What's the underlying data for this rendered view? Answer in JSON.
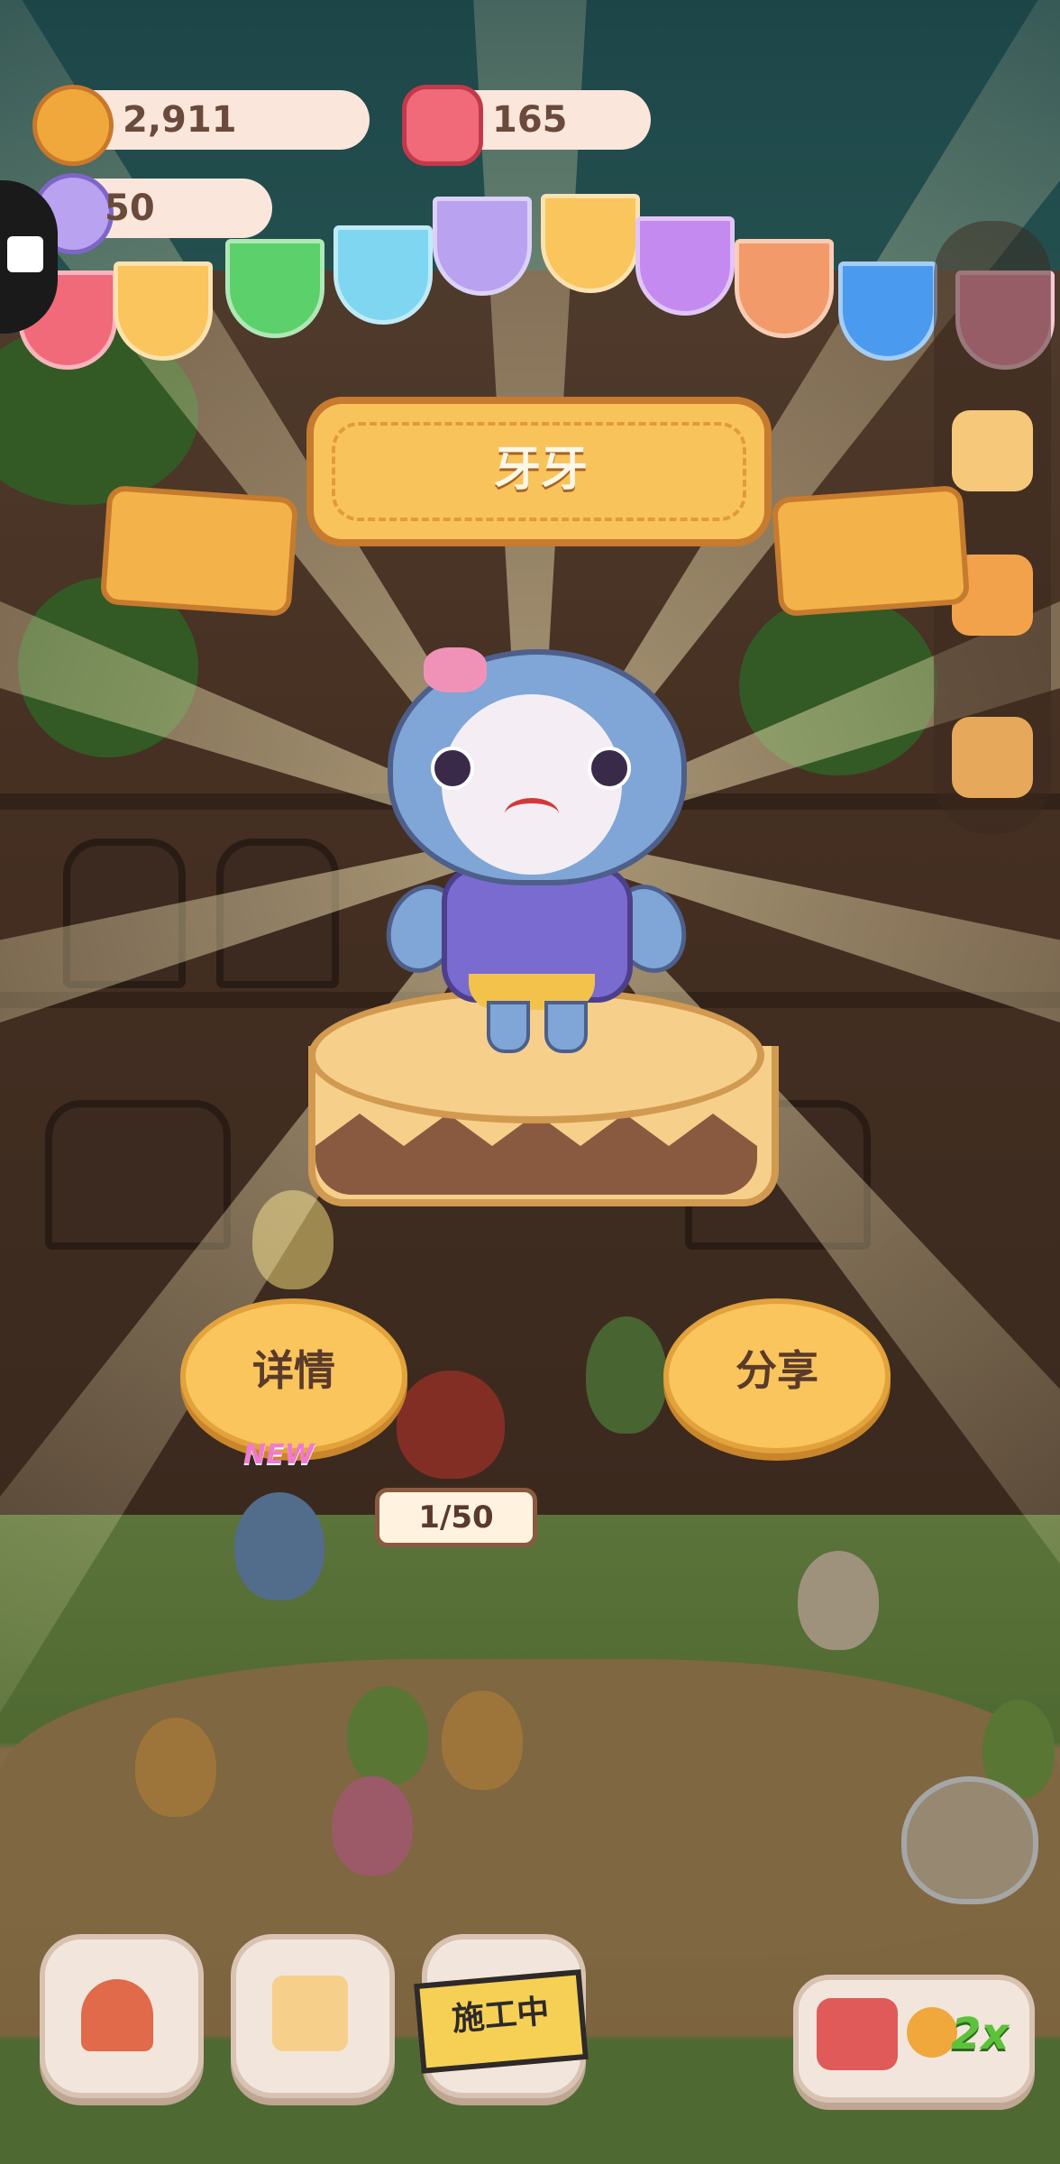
{
  "currency": {
    "cookies": "2,911",
    "gems": "165",
    "crystals": "50"
  },
  "character": {
    "name": "牙牙"
  },
  "actions": {
    "details_label": "详情",
    "share_label": "分享"
  },
  "shop": {
    "counter": "1/50",
    "new_badge": "NEW"
  },
  "bottom_nav": {
    "construction_label": "施工中",
    "boost_multiplier": "2x"
  },
  "icons": [
    "cookie-icon",
    "gem-icon",
    "crystal-icon",
    "puzzle-icon",
    "house-icon",
    "diary-icon",
    "tv-icon"
  ],
  "colors": {
    "accent": "#f9c55c",
    "ribbon": "#f8c35a",
    "boost": "#5bc23a"
  }
}
